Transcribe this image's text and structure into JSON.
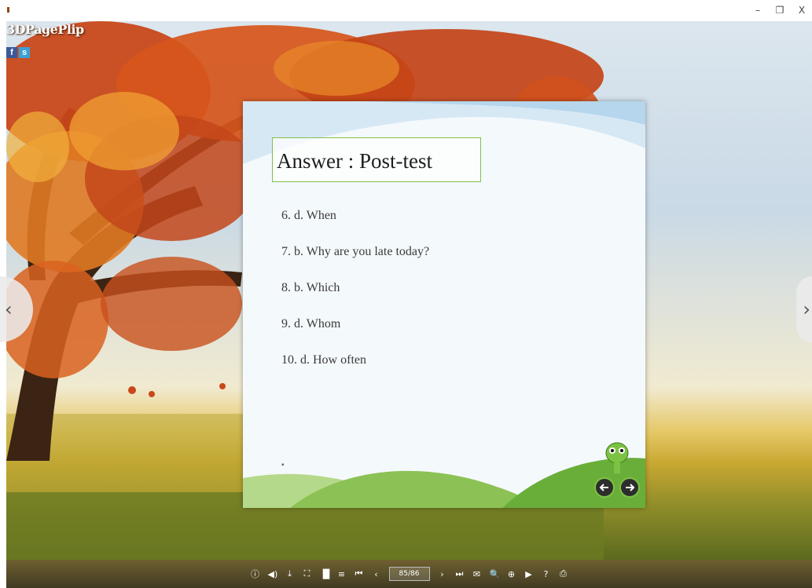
{
  "window": {
    "minimize": "–",
    "restore": "❐",
    "close": "X"
  },
  "brand": {
    "name": "3DPagePlip"
  },
  "social": {
    "facebook": "f",
    "share": "s"
  },
  "nav": {
    "prev": "‹",
    "next": "›"
  },
  "page": {
    "title": "Answer : Post-test",
    "answers": [
      "6. d. When",
      "7.   b. Why are you late today?",
      "8.   b. Which",
      "9.   d. Whom",
      "10. d. How often"
    ],
    "bullet": "▪"
  },
  "toolbar": {
    "icons": [
      {
        "name": "info-icon",
        "glyph": "ⓘ"
      },
      {
        "name": "sound-icon",
        "glyph": "◀)"
      },
      {
        "name": "download-icon",
        "glyph": "⤓"
      },
      {
        "name": "fullscreen-icon",
        "glyph": "⛶"
      },
      {
        "name": "thumbnails-icon",
        "glyph": "▐▌"
      },
      {
        "name": "table-of-contents-icon",
        "glyph": "≡"
      },
      {
        "name": "first-page-icon",
        "glyph": "⏮"
      },
      {
        "name": "previous-page-icon",
        "glyph": "‹"
      }
    ],
    "page_number": "85/86",
    "icons_right": [
      {
        "name": "next-page-icon",
        "glyph": "›"
      },
      {
        "name": "last-page-icon",
        "glyph": "⏭"
      },
      {
        "name": "email-icon",
        "glyph": "✉"
      },
      {
        "name": "search-icon",
        "glyph": "🔍"
      },
      {
        "name": "zoom-in-icon",
        "glyph": "⊕"
      },
      {
        "name": "autoplay-icon",
        "glyph": "▶"
      },
      {
        "name": "help-icon",
        "glyph": "?"
      },
      {
        "name": "print-icon",
        "glyph": "⎙"
      }
    ]
  },
  "colors": {
    "brand_text": "#ffffff",
    "title_border": "#7fbf4a",
    "toolbar": "#4a4226"
  }
}
